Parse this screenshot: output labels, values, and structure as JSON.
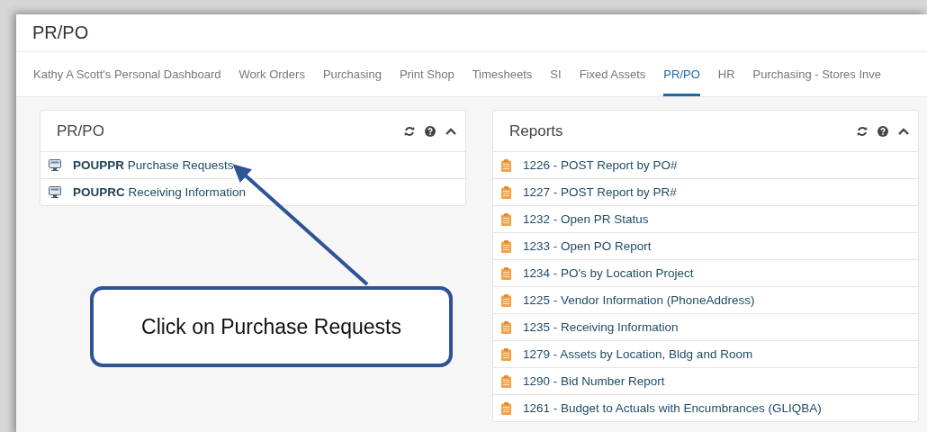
{
  "page_title": "PR/PO",
  "tabs": [
    {
      "label": "Kathy A Scott's Personal Dashboard",
      "selected": false
    },
    {
      "label": "Work Orders",
      "selected": false
    },
    {
      "label": "Purchasing",
      "selected": false
    },
    {
      "label": "Print Shop",
      "selected": false
    },
    {
      "label": "Timesheets",
      "selected": false
    },
    {
      "label": "SI",
      "selected": false
    },
    {
      "label": "Fixed Assets",
      "selected": false
    },
    {
      "label": "PR/PO",
      "selected": true
    },
    {
      "label": "HR",
      "selected": false
    },
    {
      "label": "Purchasing - Stores Inve",
      "selected": false
    }
  ],
  "panels": [
    {
      "title": "PR/PO",
      "items": [
        {
          "kind": "program",
          "code": "POUPPR",
          "label": "Purchase Requests"
        },
        {
          "kind": "program",
          "code": "POUPRC",
          "label": "Receiving Information"
        }
      ]
    },
    {
      "title": "Reports",
      "items": [
        {
          "kind": "report",
          "label": "1226 - POST Report by PO#"
        },
        {
          "kind": "report",
          "label": "1227 - POST Report by PR#"
        },
        {
          "kind": "report",
          "label": "1232 - Open PR Status"
        },
        {
          "kind": "report",
          "label": "1233 - Open PO Report"
        },
        {
          "kind": "report",
          "label": "1234 - PO's by Location Project"
        },
        {
          "kind": "report",
          "label": "1225 - Vendor Information (PhoneAddress)"
        },
        {
          "kind": "report",
          "label": "1235 - Receiving Information"
        },
        {
          "kind": "report",
          "label": "1279 - Assets by Location, Bldg and Room"
        },
        {
          "kind": "report",
          "label": "1290 - Bid Number Report"
        },
        {
          "kind": "report",
          "label": "1261 - Budget to Actuals with Encumbrances (GLIQBA)"
        }
      ]
    }
  ],
  "callout": {
    "text": "Click on Purchase Requests"
  }
}
